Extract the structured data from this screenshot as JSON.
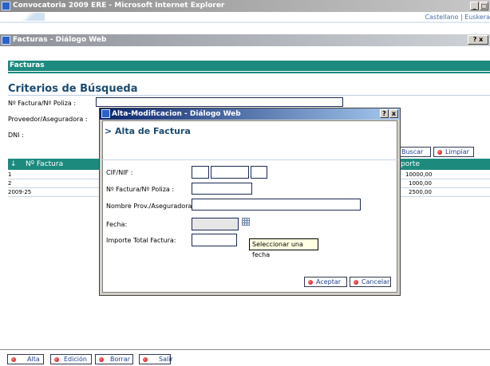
{
  "ie_window": {
    "title": "Convocatoria 2009 ERE - Microsoft Internet Explorer",
    "min": "_",
    "max": "□",
    "close": "x"
  },
  "language_links": "Castellano | Euskera",
  "facturas_dialog": {
    "title": "Facturas - Diálogo Web",
    "help": "?",
    "close": "x"
  },
  "section_header": "Facturas",
  "search": {
    "title": "Criterios de Búsqueda",
    "factura_label": "Nº Factura/Nº Poliza :",
    "proveedor_label": "Proveedor/Aseguradora :",
    "dni_label": "DNI :",
    "buscar": "Buscar",
    "limpiar": "Limpiar"
  },
  "grid": {
    "sort_arrow": "↓",
    "col_factura": "Nº Factura",
    "col_importe": "porte",
    "rows": [
      {
        "factura": "1",
        "importe": "10000,00"
      },
      {
        "factura": "2",
        "importe": "1000,00"
      },
      {
        "factura": "2009-25",
        "importe": "2500,00"
      }
    ]
  },
  "modal": {
    "title": "Alta-Modificacion - Diálogo Web",
    "help": "?",
    "close": "x",
    "heading": "> Alta de Factura",
    "cif_label": "CIF/NIF :",
    "factura_label": "Nº Factura/Nº Poliza :",
    "nombre_label": "Nombre Prov./Aseguradora :",
    "fecha_label": "Fecha:",
    "importe_label": "Importe Total Factura:",
    "tooltip": "Seleccionar una fecha",
    "aceptar": "Aceptar",
    "cancelar": "Cancelar"
  },
  "bottom_buttons": {
    "alta": "Alta",
    "edicion": "Edición",
    "borrar": "Borrar",
    "salir": "Salir"
  }
}
